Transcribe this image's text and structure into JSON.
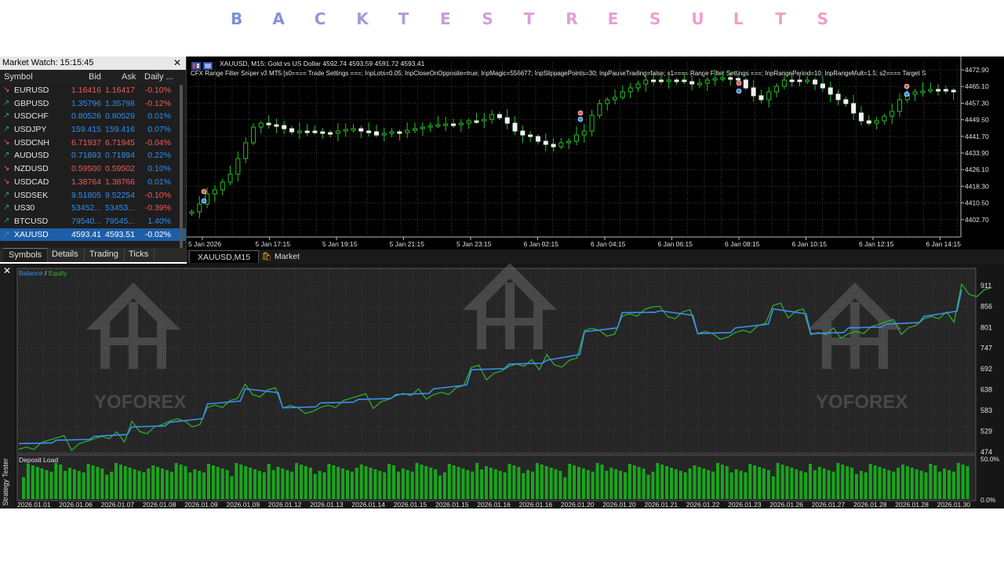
{
  "page_title": [
    "B",
    "A",
    "C",
    "K",
    "T",
    "E",
    "S",
    "T",
    "R",
    "E",
    "S",
    "U",
    "L",
    "T",
    "S"
  ],
  "title_colors": [
    "#7b91d8",
    "#8792d8",
    "#9896d6",
    "#a799d6",
    "#b89bd6",
    "#c79ed6",
    "#d39ed8",
    "#dc9fd8",
    "#e39fd6",
    "#e89fd4",
    "#ec9fd2",
    "#ef9ecf",
    "#f09ecc",
    "#f19dca",
    "#f29cc8"
  ],
  "market_watch": {
    "title": "Market Watch: 15:15:45",
    "columns": [
      "Symbol",
      "Bid",
      "Ask",
      "Daily ..."
    ],
    "rows": [
      {
        "symbol": "EURUSD",
        "bid": "1.16416",
        "ask": "1.16417",
        "daily": "-0.10%",
        "dir": "down"
      },
      {
        "symbol": "GBPUSD",
        "bid": "1.35796",
        "ask": "1.35798",
        "daily": "-0.12%",
        "dir": "up"
      },
      {
        "symbol": "USDCHF",
        "bid": "0.80526",
        "ask": "0.80529",
        "daily": "0.01%",
        "dir": "up"
      },
      {
        "symbol": "USDJPY",
        "bid": "159.415",
        "ask": "159.416",
        "daily": "0.07%",
        "dir": "up"
      },
      {
        "symbol": "USDCNH",
        "bid": "6.71937",
        "ask": "6.71945",
        "daily": "-0.04%",
        "dir": "down"
      },
      {
        "symbol": "AUDUSD",
        "bid": "0.71893",
        "ask": "0.71894",
        "daily": "0.22%",
        "dir": "up"
      },
      {
        "symbol": "NZDUSD",
        "bid": "0.59500",
        "ask": "0.59502",
        "daily": "0.10%",
        "dir": "down"
      },
      {
        "symbol": "USDCAD",
        "bid": "1.38764",
        "ask": "1.38766",
        "daily": "0.01%",
        "dir": "down"
      },
      {
        "symbol": "USDSEK",
        "bid": "9.51805",
        "ask": "9.52254",
        "daily": "-0.10%",
        "dir": "up"
      },
      {
        "symbol": "US30",
        "bid": "53452...",
        "ask": "53453...",
        "daily": "-0.39%",
        "dir": "up"
      },
      {
        "symbol": "BTCUSD",
        "bid": "79540...",
        "ask": "79545...",
        "daily": "1.40%",
        "dir": "up"
      },
      {
        "symbol": "XAUUSD",
        "bid": "4593.41",
        "ask": "4593.51",
        "daily": "-0.02%",
        "dir": "up",
        "selected": true
      }
    ],
    "tabs": [
      "Symbols",
      "Details",
      "Trading",
      "Ticks"
    ],
    "colors": {
      "up": "#2f8ef0",
      "down": "#f05a5a",
      "up_arrow": "#2aa86a",
      "down_arrow": "#f05a5a"
    }
  },
  "price_chart": {
    "info_line1": "XAUUSD, M15:  Gold vs US Dollar  4592.74 4593.59 4591.72 4593.41",
    "info_line2": "CFX Range Filter Sniper v3 MT5 [s0==== Trade Settings ===; InpLots=0.05; InpCloseOnOpposite=true; InpMagic=556677; InpSlippagePoints=30; InpPauseTrading=false; s1==== Range Filter Settings ===; InpRangePeriod=10; InpRangeMult=1.5; s2==== Target S",
    "price_labels": [
      "4472.90",
      "4465.10",
      "4457.30",
      "4449.50",
      "4441.70",
      "4433.90",
      "4426.10",
      "4418.30",
      "4410.50",
      "4402.70"
    ],
    "time_labels": [
      "5 Jan 2026",
      "5 Jan 17:15",
      "5 Jan 19:15",
      "5 Jan 21:15",
      "5 Jan 23:15",
      "6 Jan 02:15",
      "6 Jan 04:15",
      "6 Jan 06:15",
      "6 Jan 08:15",
      "6 Jan 10:15",
      "6 Jan 12:15",
      "6 Jan 14:15"
    ],
    "tabs": [
      "XAUUSD,M15",
      "Market"
    ]
  },
  "tester": {
    "side_label": "Strategy Tester",
    "legend_balance": "Balance",
    "legend_sep": " / ",
    "legend_equity": "Equity",
    "y_labels": [
      "911",
      "856",
      "801",
      "747",
      "692",
      "638",
      "583",
      "529",
      "474"
    ],
    "deposit_label": "Deposit Load",
    "deposit_pct": [
      "50.0%",
      "0.0%"
    ],
    "dates": [
      "2026.01.01",
      "2026.01.06",
      "2026.01.07",
      "2026.01.08",
      "2026.01.09",
      "2026.01.09",
      "2026.01.12",
      "2026.01.13",
      "2026.01.14",
      "2026.01.15",
      "2026.01.15",
      "2026.01.16",
      "2026.01.16",
      "2026.01.20",
      "2026.01.20",
      "2026.01.21",
      "2026.01.22",
      "2026.01.23",
      "2026.01.26",
      "2026.01.27",
      "2026.01.28",
      "2026.01.28",
      "2026.01.30"
    ],
    "watermark": "YOFOREX",
    "colors": {
      "balance": "#3a8ff0",
      "equity": "#2fb52f",
      "deposit": "#19a51c"
    }
  },
  "chart_data": [
    {
      "type": "line",
      "title": "",
      "series": [
        {
          "name": "Balance"
        },
        {
          "name": "Equity"
        }
      ],
      "x_start": "2026.01.01",
      "x_end": "2026.01.30",
      "ylim": [
        474,
        911
      ],
      "balance_points": [
        496,
        505,
        515,
        540,
        552,
        600,
        640,
        590,
        603,
        612,
        625,
        640,
        690,
        705,
        715,
        790,
        840,
        845,
        785,
        800,
        850,
        785,
        800,
        810,
        830,
        900
      ]
    }
  ]
}
